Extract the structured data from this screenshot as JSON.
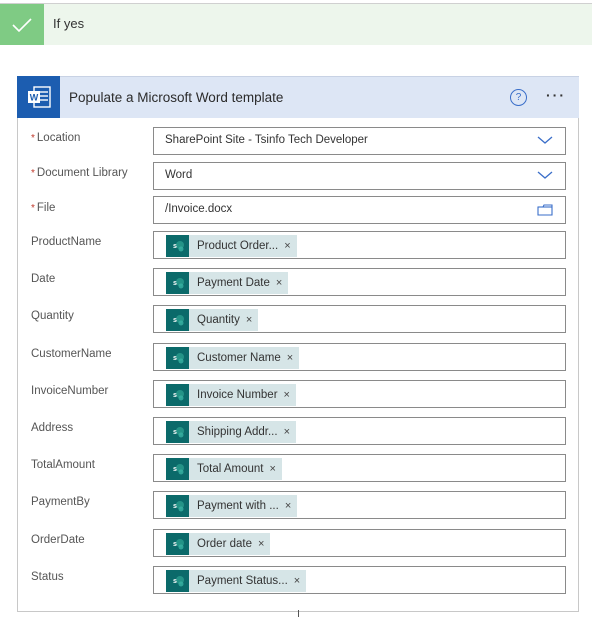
{
  "condition": {
    "label": "If yes",
    "icon": "checkmark-icon",
    "color": "#7fcb84"
  },
  "action": {
    "title": "Populate a Microsoft Word template",
    "icon": "word-icon",
    "brand_color": "#1c5db0",
    "help_label": "?",
    "more_label": "···"
  },
  "fields": [
    {
      "label": "Location",
      "required": true,
      "type": "dropdown",
      "value": "SharePoint Site - Tsinfo Tech Developer"
    },
    {
      "label": "Document Library",
      "required": true,
      "type": "dropdown",
      "value": "Word"
    },
    {
      "label": "File",
      "required": true,
      "type": "file",
      "value": "/Invoice.docx"
    }
  ],
  "required_marker": "*",
  "token_remove": "×",
  "dynamic_fields": [
    {
      "label": "ProductName",
      "token": "Product Order..."
    },
    {
      "label": "Date",
      "token": "Payment Date"
    },
    {
      "label": "Quantity",
      "token": "Quantity"
    },
    {
      "label": "CustomerName",
      "token": "Customer Name"
    },
    {
      "label": "InvoiceNumber",
      "token": "Invoice Number"
    },
    {
      "label": "Address",
      "token": "Shipping Addr..."
    },
    {
      "label": "TotalAmount",
      "token": "Total Amount"
    },
    {
      "label": "PaymentBy",
      "token": "Payment with ..."
    },
    {
      "label": "OrderDate",
      "token": "Order date"
    },
    {
      "label": "Status",
      "token": "Payment Status..."
    }
  ]
}
